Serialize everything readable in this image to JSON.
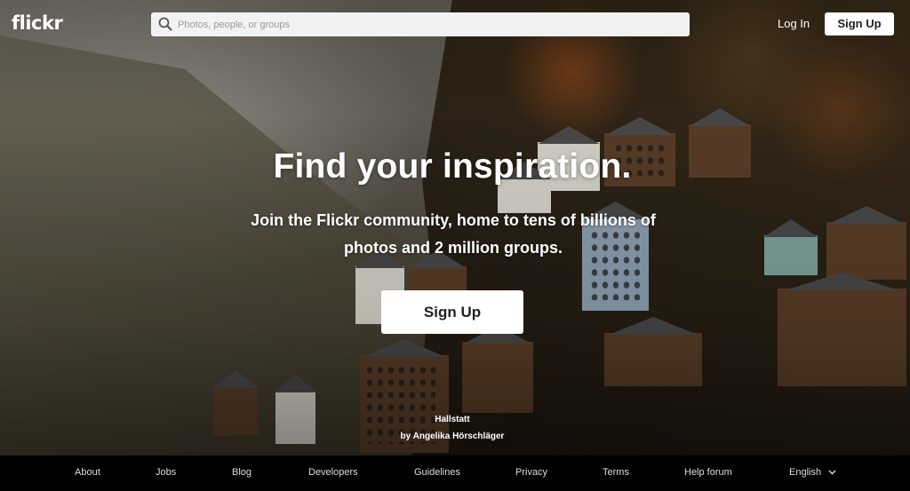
{
  "header": {
    "logo": "flickr",
    "search_placeholder": "Photos, people, or groups",
    "login_label": "Log In",
    "signup_label": "Sign Up"
  },
  "hero": {
    "headline": "Find your inspiration.",
    "subline": "Join the Flickr community, home to tens of billions of photos and 2 million groups.",
    "cta_label": "Sign Up",
    "photo_title": "Hallstatt",
    "photo_author": "by Angelika Hörschläger"
  },
  "footer": {
    "links": [
      "About",
      "Jobs",
      "Blog",
      "Developers",
      "Guidelines",
      "Privacy",
      "Terms",
      "Help forum"
    ],
    "language": "English"
  },
  "colors": {
    "button_bg": "#ffffff",
    "button_text": "#212124",
    "footer_bg": "#000000"
  }
}
